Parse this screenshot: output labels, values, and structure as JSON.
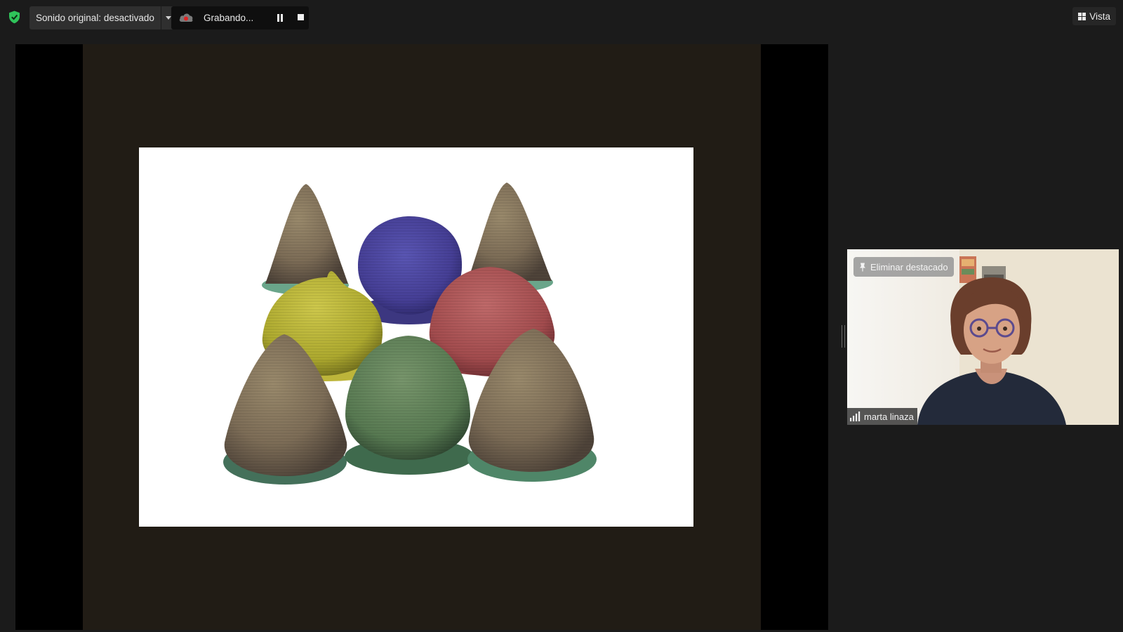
{
  "topbar": {
    "security_icon": "shield-check-icon",
    "security_color": "#2fc35a",
    "original_sound_label": "Sonido original: desactivado",
    "recording_label": "Grabando...",
    "recording_icon": "cloud-record-icon",
    "recording_color": "#e02424",
    "view_label": "Vista",
    "view_icon": "grid-icon"
  },
  "shared_screen": {
    "slide_description_colors": {
      "background": "#211c15",
      "slide": "#ffffff"
    }
  },
  "video_tile": {
    "unpin_label": "Eliminar destacado",
    "unpin_icon": "pin-icon",
    "participant_name": "marta linaza",
    "signal_icon": "signal-bars-icon"
  }
}
